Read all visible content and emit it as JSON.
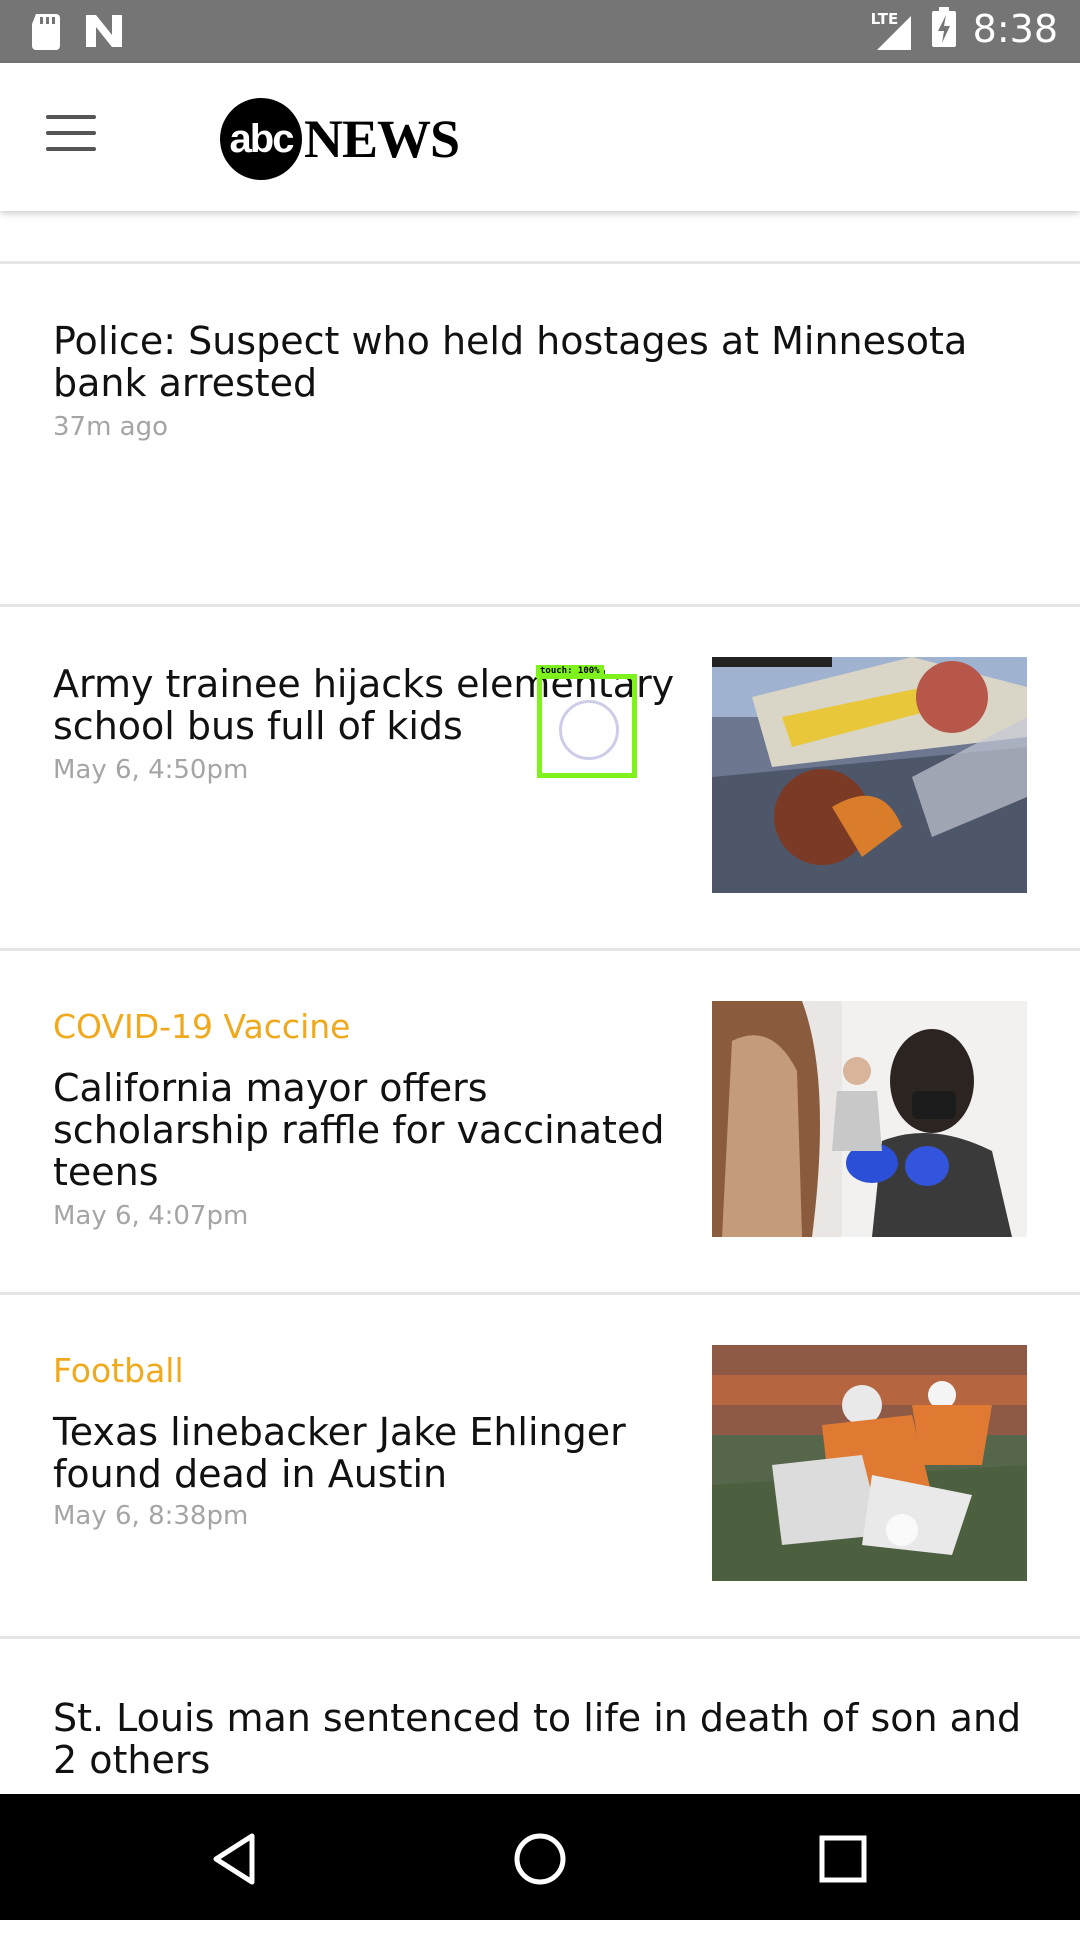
{
  "status_bar": {
    "time": "8:38",
    "network": "LTE",
    "icons": [
      "sd-card-icon",
      "n-notification-icon",
      "signal-icon",
      "battery-charging-icon"
    ]
  },
  "app_bar": {
    "logo_abc": "abc",
    "logo_news": "NEWS"
  },
  "articles": [
    {
      "headline_line1": "Police: Suspect who held hostages at Minnesota",
      "headline_line2": "bank arrested",
      "time": "37m ago"
    },
    {
      "headline_line1": "Army trainee hijacks elementary",
      "headline_line2": "school bus full of kids",
      "time": "May 6, 4:50pm"
    },
    {
      "kicker": "COVID-19 Vaccine",
      "headline_line1": "California mayor offers",
      "headline_line2": "scholarship raffle for vaccinated",
      "headline_line3": "teens",
      "time": "May 6, 4:07pm"
    },
    {
      "kicker": "Football",
      "headline_line1": "Texas linebacker Jake Ehlinger",
      "headline_line2": "found dead in Austin",
      "time": "May 6, 8:38pm"
    },
    {
      "headline_line1": "St. Louis man sentenced to life in death of son and",
      "headline_line2": "2 others"
    }
  ],
  "touch_indicator": {
    "label": "touch: 100%"
  },
  "colors": {
    "kicker": "#f0a81c",
    "touch": "#7ff11c",
    "status_bar": "#757575"
  }
}
